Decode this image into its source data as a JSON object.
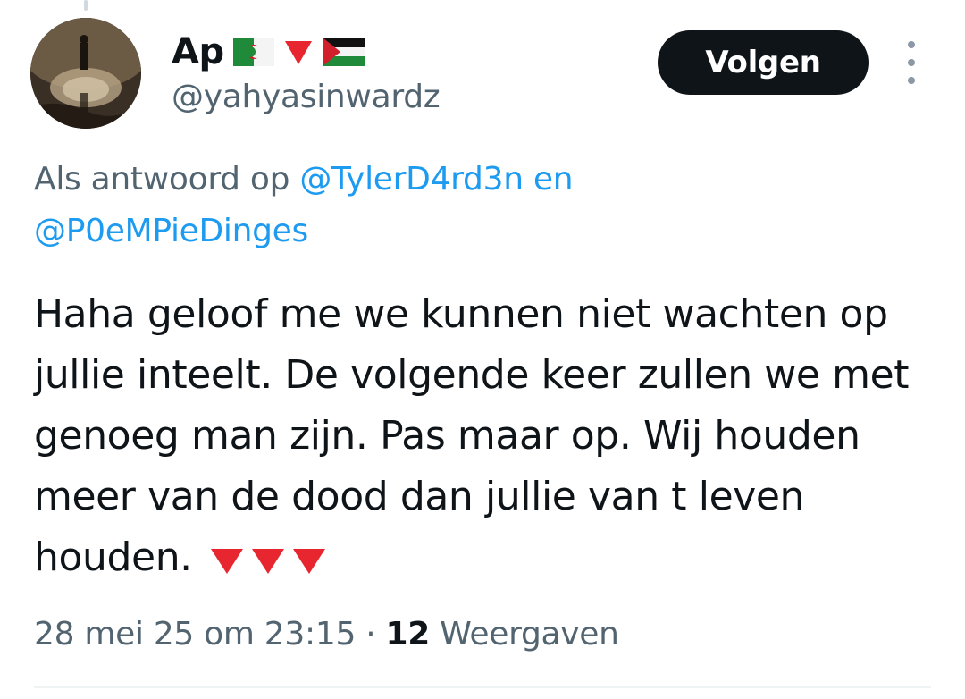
{
  "author": {
    "display_name": "Ap",
    "handle": "@yahyasinwardz",
    "name_emojis": [
      "algeria-flag",
      "red-triangle-down",
      "palestine-flag"
    ]
  },
  "actions": {
    "follow_label": "Volgen",
    "more_icon": "more-vertical-icon"
  },
  "reply_context": {
    "prefix": "Als antwoord op",
    "mention_1": "@TylerD4rd3n",
    "conjunction": "en",
    "mention_2": "@P0eMPieDinges"
  },
  "tweet": {
    "text": "Haha geloof me we kunnen niet wachten op jullie inteelt. De volgende keer zullen we met genoeg man zijn. Pas maar op. Wij houden meer van de dood dan jullie van t leven houden.",
    "trailing_emojis": [
      "red-triangle-down",
      "red-triangle-down",
      "red-triangle-down"
    ]
  },
  "meta": {
    "timestamp": "28 mei 25 om 23:15",
    "separator": "·",
    "views_count": "12",
    "views_label": "Weergaven"
  },
  "colors": {
    "text_primary": "#0f1419",
    "text_secondary": "#536471",
    "link": "#1d9bf0",
    "follow_bg": "#0f1419",
    "triangle_red": "#e8262f"
  }
}
